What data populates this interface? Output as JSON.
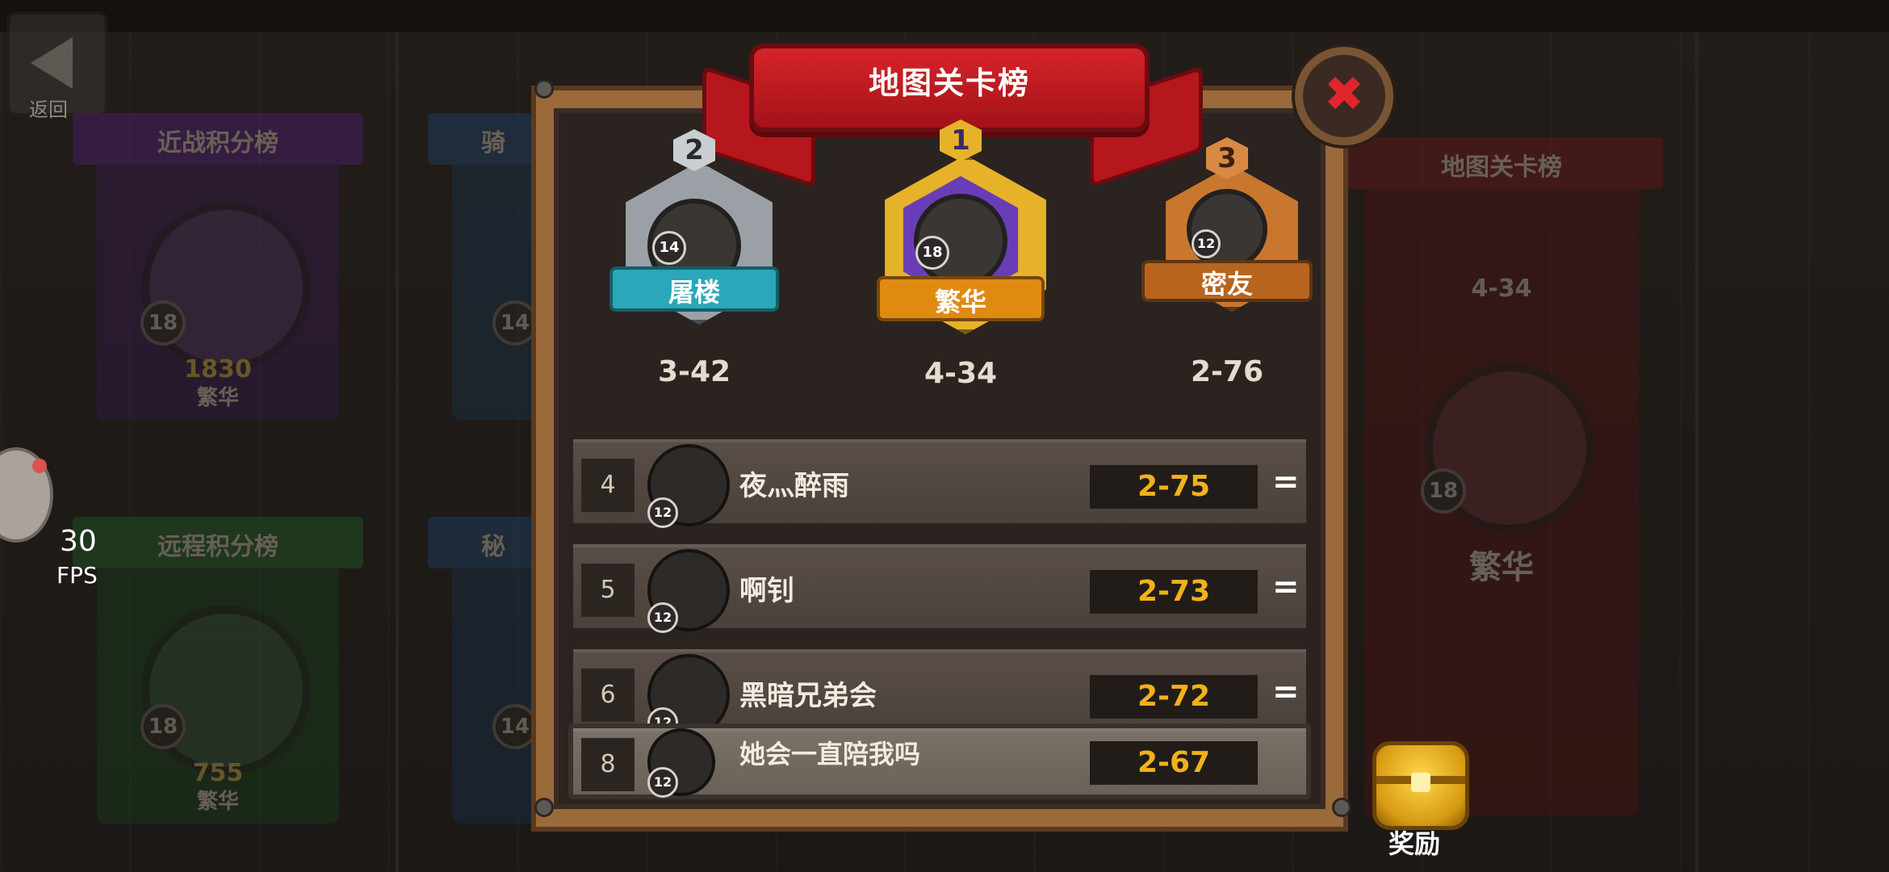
{
  "background": {
    "back_label": "返回",
    "fps_value": "30",
    "fps_label": "FPS",
    "banners": [
      {
        "title": "近战积分榜",
        "level": "18",
        "score": "1830",
        "guild": "繁华",
        "color": "#5a1f8a"
      },
      {
        "title": "骑",
        "level": "14",
        "score": "",
        "guild": "",
        "color": "#1f4a7a"
      },
      {
        "title": "远程积分榜",
        "level": "18",
        "score": "755",
        "guild": "繁华",
        "color": "#1f6a2a"
      },
      {
        "title": "秘",
        "level": "14",
        "score": "",
        "guild": "",
        "color": "#1f4a7a"
      },
      {
        "title": "地图关卡榜",
        "level": "18",
        "score": "4-34",
        "guild": "繁华",
        "color": "#7a1518"
      }
    ]
  },
  "modal": {
    "title": "地图关卡榜",
    "close_icon": "close-x-icon",
    "podium": [
      {
        "rank": "2",
        "level": "14",
        "name": "屠楼",
        "score": "3-42",
        "frame_color": "#9aa0a6",
        "plate_color": "#2aa7b8"
      },
      {
        "rank": "1",
        "level": "18",
        "name": "繁华",
        "score": "4-34",
        "frame_color": "#e6b22a",
        "plate_color": "#e08a12"
      },
      {
        "rank": "3",
        "level": "12",
        "name": "密友",
        "score": "2-76",
        "frame_color": "#c9772e",
        "plate_color": "#b8641e"
      }
    ],
    "rows": [
      {
        "rank": "4",
        "level": "12",
        "name": "夜灬醉雨",
        "score": "2-75",
        "trend": "="
      },
      {
        "rank": "5",
        "level": "12",
        "name": "啊钊",
        "score": "2-73",
        "trend": "="
      },
      {
        "rank": "6",
        "level": "12",
        "name": "黑暗兄弟会",
        "score": "2-72",
        "trend": "="
      }
    ],
    "my_row": {
      "rank": "8",
      "level": "12",
      "name": "她会一直陪我吗",
      "score": "2-67"
    }
  },
  "reward": {
    "label": "奖励",
    "icon": "treasure-chest-icon"
  },
  "colors": {
    "score_gold": "#f2b11c",
    "ribbon_red": "#d6242a",
    "close_red": "#e0262c"
  }
}
